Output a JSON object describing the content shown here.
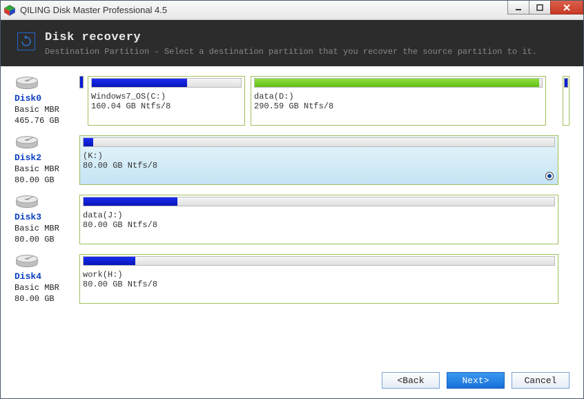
{
  "window": {
    "title": "QILING Disk Master Professional 4.5"
  },
  "header": {
    "title": "Disk recovery",
    "subtitle": "Destination Partition - Select a destination partition that you recover the source partition to it."
  },
  "disks": [
    {
      "name": "Disk0",
      "type": "Basic MBR",
      "size": "465.76 GB",
      "hasLeadMark": true,
      "hasTailSlice": true,
      "partitions": [
        {
          "label": "Windows7_OS(C:)",
          "detail": "160.04 GB Ntfs/8",
          "fillColor": "blue",
          "fillPercent": 64,
          "widthPx": 228,
          "selected": false
        },
        {
          "label": "data(D:)",
          "detail": "290.59 GB Ntfs/8",
          "fillColor": "green",
          "fillPercent": 99,
          "widthPx": 428,
          "selected": false
        }
      ]
    },
    {
      "name": "Disk2",
      "type": "Basic MBR",
      "size": "80.00 GB",
      "hasLeadMark": false,
      "hasTailSlice": false,
      "partitions": [
        {
          "label": "(K:)",
          "detail": "80.00 GB Ntfs/8",
          "fillColor": "blue",
          "fillPercent": 2,
          "widthPx": 694,
          "selected": true
        }
      ]
    },
    {
      "name": "Disk3",
      "type": "Basic MBR",
      "size": "80.00 GB",
      "hasLeadMark": false,
      "hasTailSlice": false,
      "partitions": [
        {
          "label": "data(J:)",
          "detail": "80.00 GB Ntfs/8",
          "fillColor": "blue",
          "fillPercent": 20,
          "widthPx": 694,
          "selected": false
        }
      ]
    },
    {
      "name": "Disk4",
      "type": "Basic MBR",
      "size": "80.00 GB",
      "hasLeadMark": false,
      "hasTailSlice": false,
      "partitions": [
        {
          "label": "work(H:)",
          "detail": "80.00 GB Ntfs/8",
          "fillColor": "blue",
          "fillPercent": 11,
          "widthPx": 694,
          "selected": false
        }
      ]
    }
  ],
  "buttons": {
    "back": "<Back",
    "next": "Next>",
    "cancel": "Cancel"
  }
}
